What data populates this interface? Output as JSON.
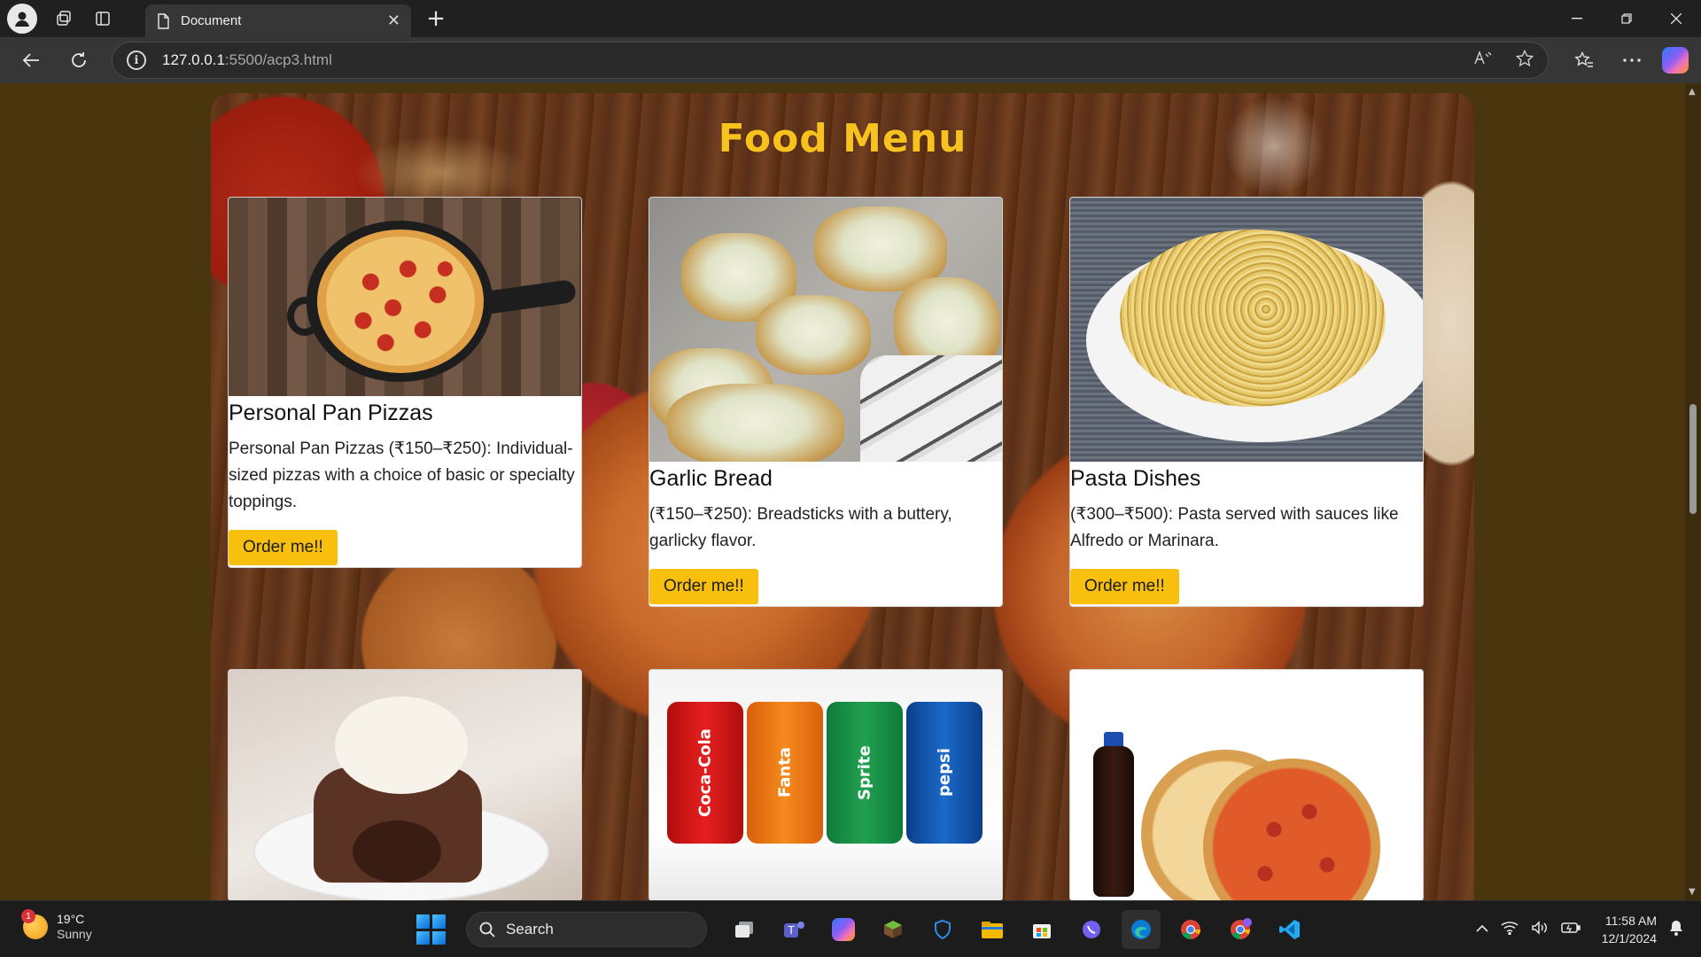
{
  "browser": {
    "tab_title": "Document",
    "url_host": "127.0.0.1",
    "url_path": ":5500/acp3.html",
    "new_tab_symbol": "+",
    "close_symbol": "✕"
  },
  "page": {
    "title": "Food Menu",
    "title_color": "#f7c21d",
    "button_color": "#f8bf0d",
    "cards": [
      {
        "title": "Personal Pan Pizzas",
        "description": "Personal Pan Pizzas (₹150–₹250): Individual-sized pizzas with a choice of basic or specialty toppings.",
        "button": "Order me!!",
        "image": "pan-pizza-photo"
      },
      {
        "title": "Garlic Bread",
        "description": "(₹150–₹250): Breadsticks with a buttery, garlicky flavor.",
        "button": "Order me!!",
        "image": "garlic-bread-photo"
      },
      {
        "title": "Pasta Dishes",
        "description": "(₹300–₹500): Pasta served with sauces like Alfredo or Marinara.",
        "button": "Order me!!",
        "image": "pasta-photo"
      },
      {
        "image": "chocolate-lava-cake-photo"
      },
      {
        "image": "soft-drinks-photo",
        "cans": [
          "Coca-Cola",
          "Fanta",
          "Sprite",
          "pepsi"
        ]
      },
      {
        "image": "pizza-and-pepsi-combo-photo"
      }
    ]
  },
  "taskbar": {
    "weather_temp": "19°C",
    "weather_condition": "Sunny",
    "weather_badge": "1",
    "search_label": "Search",
    "time": "11:58 AM",
    "date": "12/1/2024"
  }
}
